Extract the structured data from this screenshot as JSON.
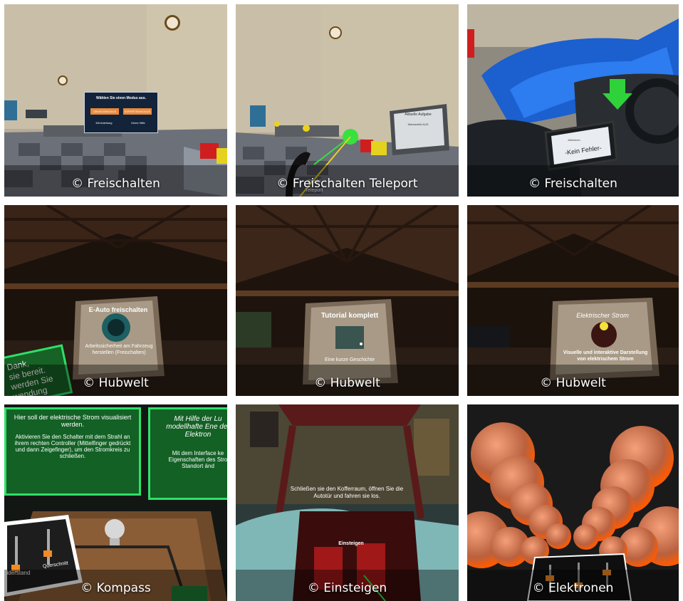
{
  "tiles": [
    {
      "caption": "© Freischalten",
      "menu": {
        "title": "Wählen Sie einen Modus aus.",
        "btn_practice": "ÜBUNGSMODUS",
        "btn_expert": "EXPERTENMODUS",
        "opt_guided": "Mit Anleitung",
        "opt_no_help": "Keine Hilfe"
      }
    },
    {
      "caption": "© Freischalten Teleport",
      "panel": {
        "header": "Aktuelle Aufgabe",
        "task": "Warnschild AUS"
      },
      "controller_label": "Strahl",
      "teleport_label": "Teleport"
    },
    {
      "caption": "© Freischalten",
      "device_label": "Aktivieren",
      "device_text": "-Kein Fehler-"
    },
    {
      "caption": "© Hubwelt",
      "board": {
        "title": "E-Auto freischalten",
        "desc": "Arbeitssicherheit am Fahrzeug herstellen (Freischalten)"
      },
      "side_panel": {
        "line1": "Dank,",
        "line2": "sie bereit.",
        "line3": "werden Sie",
        "line4": "wendung"
      }
    },
    {
      "caption": "© Hubwelt",
      "board": {
        "title": "Tutorial komplett",
        "desc": "Eine kurze Geschichte"
      }
    },
    {
      "caption": "© Hubwelt",
      "board": {
        "title": "Elektrischer Strom",
        "desc": "Visuelle und interaktive Darstellung von elektrischem Strom"
      }
    },
    {
      "caption": "© Kompass",
      "panel_left": {
        "heading": "Hier soll der elektrische Strom visualisiert werden.",
        "body": "Aktivieren Sie den Schalter mit dem Strahl an ihrem rechten Controller (Mittelfinger gedrückt und dann Zeigefinger), um den Stromkreis zu schließen."
      },
      "panel_right": {
        "heading": "Mit Hilfe der Lu modellhafte Ene der Elektron",
        "body": "Mit dem Interface ke Eigenschaften des Stro Standort änd"
      },
      "slider_labels": {
        "left": "iderstand",
        "right": "Querschnitt"
      }
    },
    {
      "caption": "© Einsteigen",
      "instruction": "Schließen sie den Kofferraum, öffnen Sie die Autotür und fahren sie los.",
      "action_label": "Einsteigen"
    },
    {
      "caption": "© Elektronen"
    }
  ]
}
